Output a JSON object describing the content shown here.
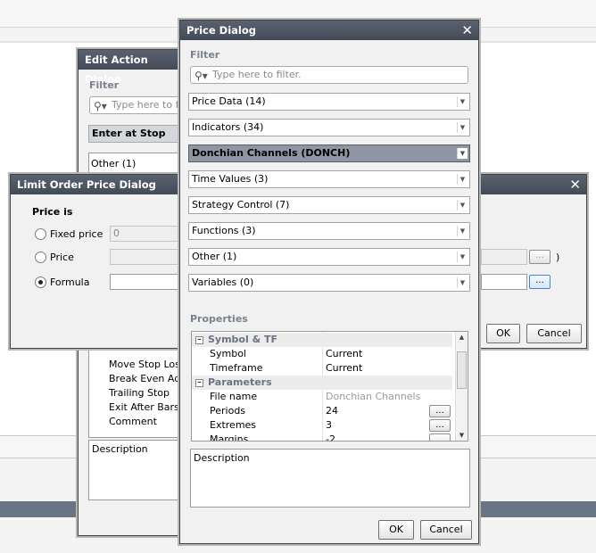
{
  "edit_action": {
    "title": "Edit Action Dialog",
    "filter_label": "Filter",
    "filter_placeholder": "Type here to fi",
    "selected_item": "Enter at Stop",
    "other_item": "Other (1)",
    "actions": [
      "Move Stop Loss",
      "Break Even Add",
      "Trailing Stop",
      "Exit After Bars",
      "Comment"
    ],
    "description_label": "Description"
  },
  "limit_order": {
    "title": "Limit Order Price Dialog",
    "heading": "Price is",
    "options": [
      "Fixed price",
      "Price",
      "Formula"
    ],
    "selected_option": "Formula",
    "fixed_value": "0",
    "close_paren": ")",
    "ellipsis": "...",
    "ok_label": "OK",
    "cancel_label": "Cancel"
  },
  "price_dialog": {
    "title": "Price Dialog",
    "filter_label": "Filter",
    "filter_placeholder": "Type here to filter.",
    "categories": [
      "Price Data (14)",
      "Indicators (34)",
      "Donchian Channels (DONCH)",
      "Time Values (3)",
      "Strategy Control (7)",
      "Functions (3)",
      "Other (1)",
      "Variables (0)"
    ],
    "selected_category": "Donchian Channels (DONCH)",
    "properties_label": "Properties",
    "property_groups": [
      {
        "name": "Symbol & TF",
        "rows": [
          {
            "key": "Symbol",
            "value": "Current"
          },
          {
            "key": "Timeframe",
            "value": "Current"
          }
        ]
      },
      {
        "name": "Parameters",
        "rows": [
          {
            "key": "File name",
            "value": "Donchian Channels"
          },
          {
            "key": "Periods",
            "value": "24"
          },
          {
            "key": "Extremes",
            "value": "3"
          },
          {
            "key": "Margins",
            "value": "-2"
          }
        ]
      }
    ],
    "ellipsis": "...",
    "description_label": "Description",
    "ok_label": "OK",
    "cancel_label": "Cancel"
  },
  "icons": {
    "close": "close-icon",
    "search": "search-icon",
    "dropdown": "chevron-down-icon"
  },
  "colors": {
    "titlebar": "#4d5461",
    "selection": "#8e96a4",
    "section_label": "#7a8290"
  }
}
